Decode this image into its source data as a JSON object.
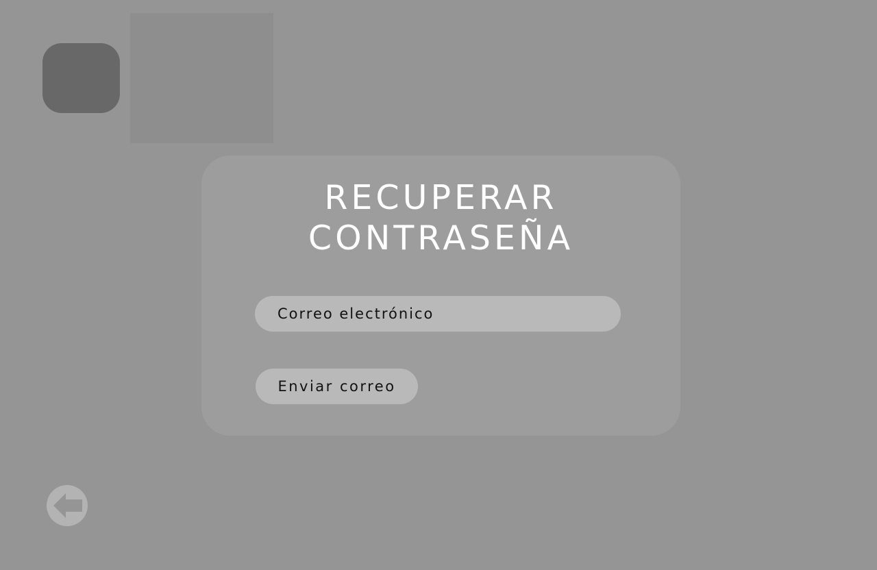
{
  "header": {
    "logo_icon": "logo-placeholder",
    "image_icon": "image-placeholder"
  },
  "recover_card": {
    "title_line1": "RECUPERAR",
    "title_line2": "CONTRASEÑA",
    "email_placeholder": "Correo electrónico",
    "email_value": "",
    "send_label": "Enviar correo"
  },
  "navigation": {
    "back_icon": "arrow-left-icon"
  },
  "colors": {
    "background": "#959595",
    "card": "#9d9d9d",
    "field": "#b9b9b9",
    "title_text": "#ffffff",
    "logo_tile": "#686868",
    "back_button": "#b3b3b3"
  }
}
